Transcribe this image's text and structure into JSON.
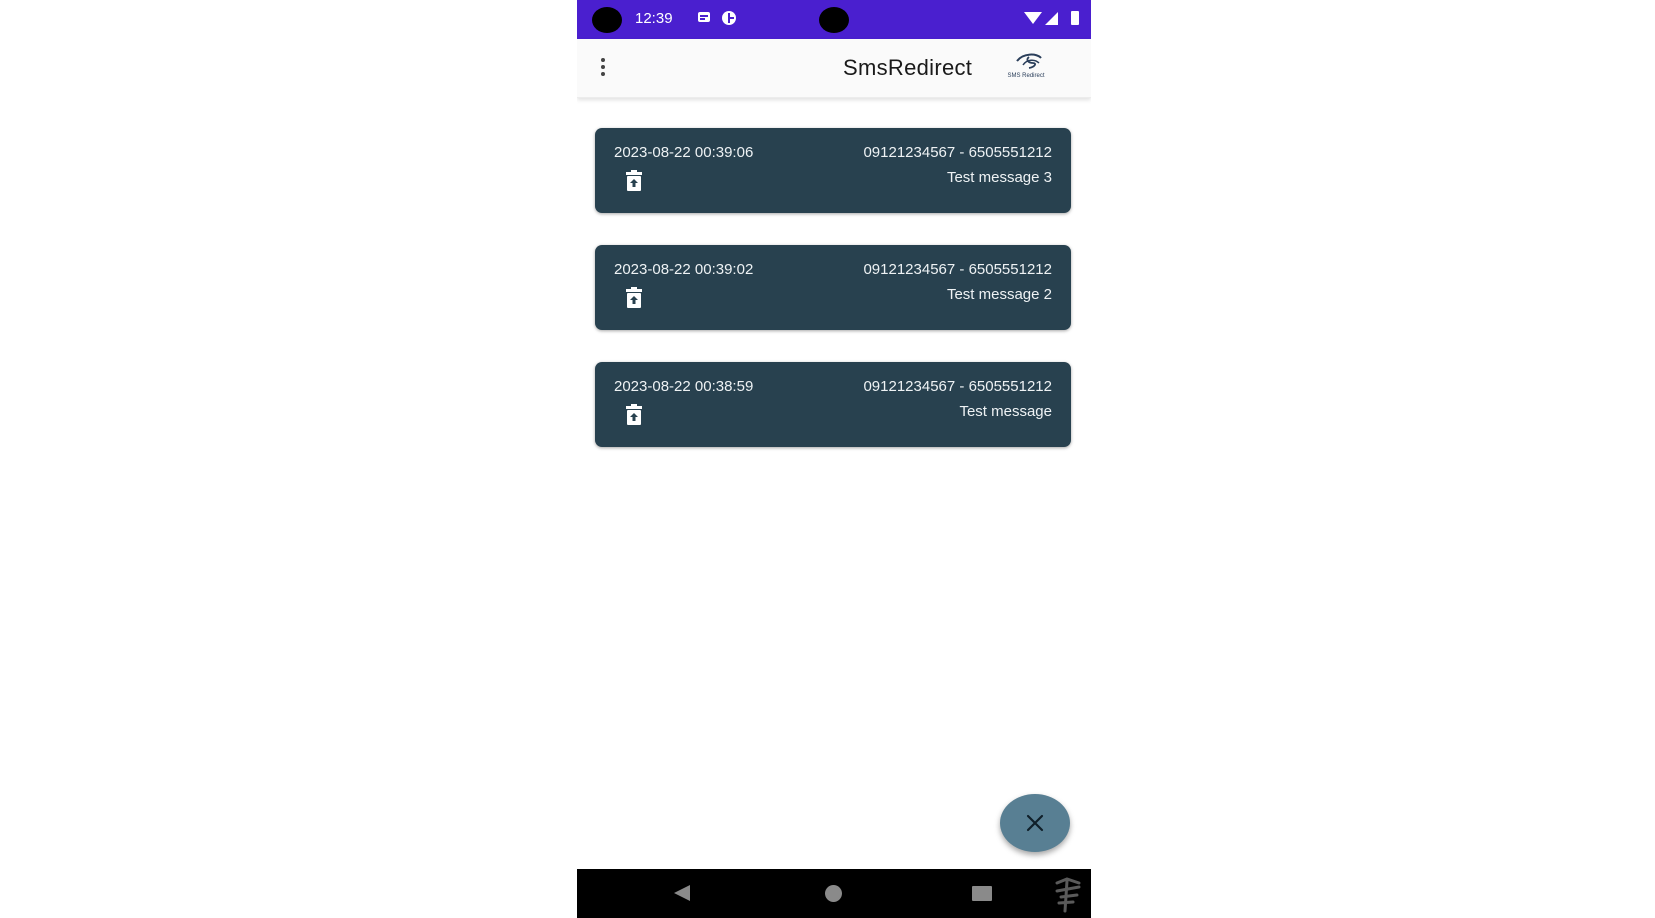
{
  "status_bar": {
    "time": "12:39",
    "icons": [
      "message-notification-icon",
      "data-saver-icon",
      "wifi-icon",
      "signal-icon",
      "battery-icon"
    ],
    "color": "#4a1fcf"
  },
  "app_bar": {
    "title": "SmsRedirect",
    "logo_text": "SMS Redirect",
    "menu_icon": "more-vert-icon"
  },
  "messages": [
    {
      "date": "2023-08-22 00:39:06",
      "numbers": "09121234567 - 6505551212",
      "text": "Test message 3"
    },
    {
      "date": "2023-08-22 00:39:02",
      "numbers": "09121234567 - 6505551212",
      "text": "Test message 2"
    },
    {
      "date": "2023-08-22 00:38:59",
      "numbers": "09121234567 - 6505551212",
      "text": "Test message"
    }
  ],
  "fab": {
    "icon": "close-icon"
  },
  "nav_bar": {
    "icons": [
      "back-icon",
      "home-icon",
      "recents-icon"
    ]
  },
  "colors": {
    "card": "#28414f",
    "fab": "#587f93",
    "status_bar": "#4a1fcf"
  }
}
